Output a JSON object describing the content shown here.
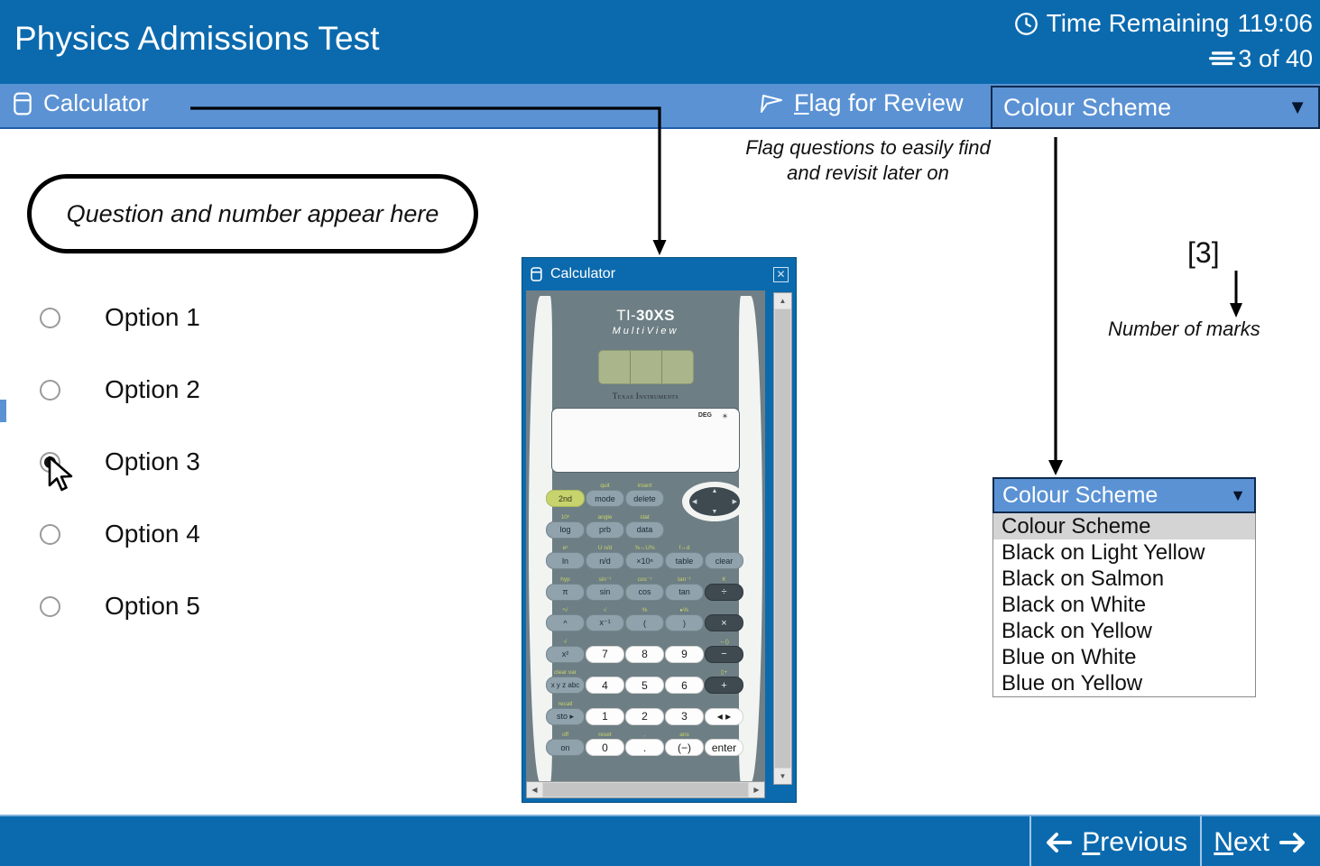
{
  "header": {
    "exam_title": "Physics Admissions Test",
    "timer_label": "Time Remaining",
    "timer_value": "119:06",
    "clock_icon": "clock-icon",
    "progress_text": "3 of 40",
    "pages_icon": "pages-icon",
    "bg_color": "#0b6aae"
  },
  "toolbar": {
    "calculator_label": "Calculator",
    "calculator_icon": "calculator-icon",
    "flag_icon": "flag-icon",
    "flag_accel": "F",
    "flag_rest": "lag for Review",
    "scheme_label": "Colour Scheme",
    "caret_icon": "chevron-down-icon",
    "bg_color": "#5b92d4"
  },
  "annotations": {
    "question_bubble": "Question and number appear here",
    "flag_note_line1": "Flag questions to easily find",
    "flag_note_line2": "and revisit later on",
    "marks_value": "[3]",
    "marks_note": "Number of marks"
  },
  "options": {
    "items": [
      {
        "label": "Option 1",
        "selected": false
      },
      {
        "label": "Option 2",
        "selected": false
      },
      {
        "label": "Option 3",
        "selected": true
      },
      {
        "label": "Option 4",
        "selected": false
      },
      {
        "label": "Option 5",
        "selected": false
      }
    ]
  },
  "calculator": {
    "window_title": "Calculator",
    "window_icon": "calculator-icon",
    "close_icon": "close-icon",
    "brand_ti": "TI-",
    "brand_model": "30XS",
    "brand_sub": "MultiView",
    "manufacturer": "Texas Instruments",
    "lcd_mode": "DEG",
    "lcd_solar": "☀",
    "scroll_up_icon": "triangle-up-icon",
    "scroll_down_icon": "triangle-down-icon",
    "scroll_left_icon": "triangle-left-icon",
    "scroll_right_icon": "triangle-right-icon",
    "keys": {
      "row1": {
        "secondary": [
          "",
          "quit",
          "insert"
        ],
        "keys": [
          "2nd",
          "mode",
          "delete"
        ]
      },
      "row2": {
        "secondary": [
          "10ˣ",
          "angle",
          "stat"
        ],
        "keys": [
          "log",
          "prb",
          "data"
        ]
      },
      "row3": {
        "secondary": [
          "eˣ",
          "U n/d",
          "⅜↔U⅜",
          "f↔d"
        ],
        "keys": [
          "ln",
          "n/d",
          "×10ⁿ",
          "table",
          "clear"
        ]
      },
      "row4": {
        "secondary": [
          "hyp",
          "sin⁻¹",
          "cos⁻¹",
          "tan⁻¹",
          "K"
        ],
        "keys": [
          "π",
          "sin",
          "cos",
          "tan",
          "÷"
        ]
      },
      "row5": {
        "secondary": [
          "ˣ√",
          "√",
          "%",
          "▸%"
        ],
        "keys": [
          "^",
          "x⁻¹",
          "(",
          ")",
          "×"
        ]
      },
      "row6": {
        "secondary": [
          "√",
          "",
          "",
          "",
          "↔()"
        ],
        "keys": [
          "x²",
          "7",
          "8",
          "9",
          "−"
        ]
      },
      "row7": {
        "secondary": [
          "clear var",
          "",
          "",
          "",
          "▯+"
        ],
        "keys": [
          "x y z abc",
          "4",
          "5",
          "6",
          "+"
        ]
      },
      "row8": {
        "secondary": [
          "recall",
          "",
          "",
          "",
          ""
        ],
        "keys": [
          "sto ▸",
          "1",
          "2",
          "3",
          "◂ ▸"
        ]
      },
      "row9": {
        "secondary": [
          "off",
          "reset",
          ",",
          "ans",
          ""
        ],
        "keys": [
          "on",
          "0",
          ".",
          "(−)",
          "enter"
        ]
      }
    }
  },
  "dropdown": {
    "header_label": "Colour Scheme",
    "caret_icon": "chevron-down-icon",
    "options": [
      "Colour Scheme",
      "Black on Light Yellow",
      "Black on Salmon",
      "Black on White",
      "Black on Yellow",
      "Blue on White",
      "Blue on Yellow"
    ],
    "selected_index": 0
  },
  "footer": {
    "previous_accel": "P",
    "previous_rest": "revious",
    "previous_icon": "arrow-left-icon",
    "next_accel": "N",
    "next_rest": "ext",
    "next_icon": "arrow-right-icon"
  }
}
